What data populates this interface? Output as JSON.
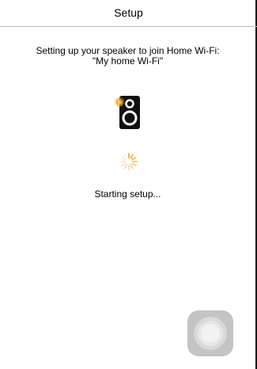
{
  "nav": {
    "title": "Setup"
  },
  "message": {
    "line1": "Setting up your speaker to join Home Wi-Fi:",
    "line2": "\"My home Wi-Fi\""
  },
  "speaker": {
    "icon": "speaker-icon",
    "indicator_color": "#f5a623"
  },
  "spinner": {
    "icon": "loading-spinner-icon",
    "color": "#f5a623"
  },
  "status": {
    "text": "Starting setup..."
  },
  "assistive_touch": {
    "icon": "assistive-touch-icon"
  }
}
